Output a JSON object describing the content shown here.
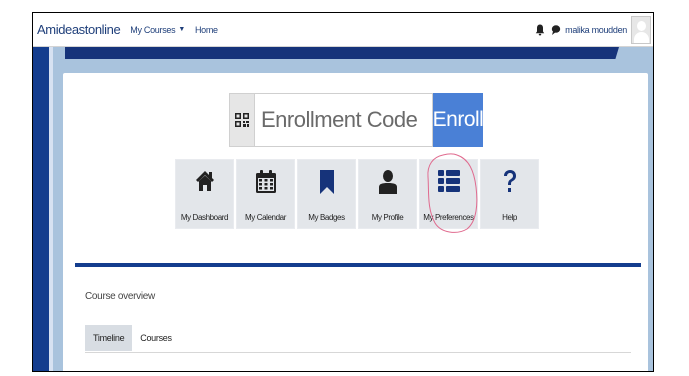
{
  "navbar": {
    "brand": "Amideastonline",
    "links": [
      {
        "label": "My Courses",
        "has_caret": true
      },
      {
        "label": "Home",
        "has_caret": false
      }
    ],
    "username": "malika moudden",
    "icons": [
      "bell-icon",
      "chat-icon",
      "avatar"
    ]
  },
  "enroll": {
    "placeholder": "Enrollment Code",
    "button_label": "Enroll",
    "qr_icon": "qr-code-icon"
  },
  "tiles": [
    {
      "label": "My Dashboard",
      "icon": "home-icon"
    },
    {
      "label": "My Calendar",
      "icon": "calendar-icon"
    },
    {
      "label": "My Badges",
      "icon": "bookmark-icon"
    },
    {
      "label": "My Profile",
      "icon": "user-icon"
    },
    {
      "label": "My Preferences",
      "icon": "list-icon"
    },
    {
      "label": "Help",
      "icon": "question-icon"
    }
  ],
  "course_overview": {
    "title": "Course overview",
    "tabs": [
      {
        "label": "Timeline",
        "active": true
      },
      {
        "label": "Courses",
        "active": false
      }
    ]
  },
  "colors": {
    "brand_blue": "#143d8e",
    "enroll_blue": "#4a80d6",
    "page_bg": "#a9c3dd",
    "tile_bg": "#e3e6ea",
    "highlight": "#e06a8e"
  }
}
